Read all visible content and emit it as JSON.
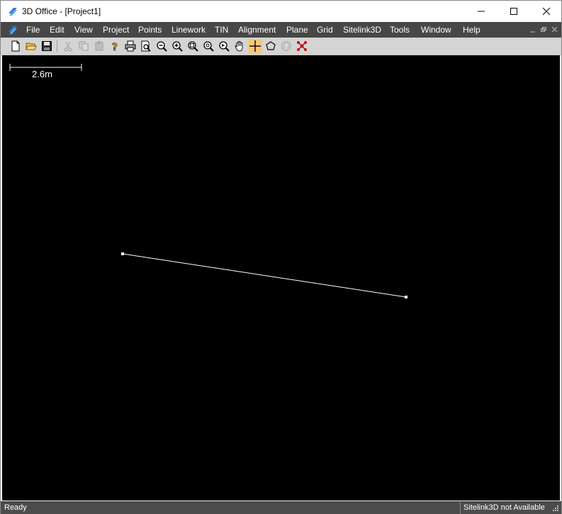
{
  "window": {
    "title": "3D Office - [Project1]"
  },
  "menu": {
    "items": [
      "File",
      "Edit",
      "View",
      "Project",
      "Points",
      "Linework",
      "TIN",
      "Alignment",
      "Plane",
      "Grid",
      "Sitelink3D",
      "Tools",
      "Window",
      "Help"
    ]
  },
  "toolbar": {
    "buttons": [
      "new",
      "open",
      "save",
      "cut",
      "copy",
      "paste",
      "help",
      "print",
      "print-preview",
      "zoom-out",
      "zoom-in",
      "zoom-window",
      "zoom-extents",
      "zoom-previous",
      "pan",
      "crosshair",
      "polygon",
      "disabled-help",
      "network"
    ]
  },
  "canvas": {
    "scale_label": "2.6m"
  },
  "status": {
    "ready": "Ready",
    "sitelink": "Sitelink3D not Available"
  }
}
